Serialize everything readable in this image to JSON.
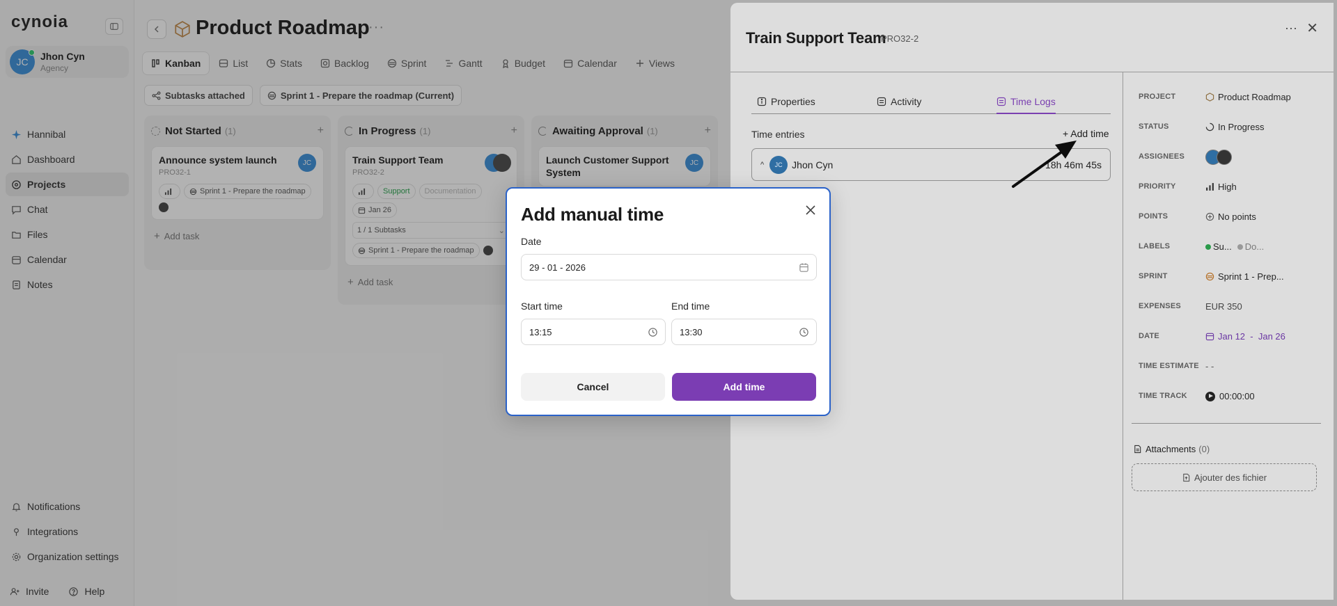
{
  "app": {
    "logo": "cynoia"
  },
  "user": {
    "initials": "JC",
    "name": "Jhon Cyn",
    "role": "Agency"
  },
  "nav": {
    "items": [
      {
        "label": "Hannibal"
      },
      {
        "label": "Dashboard"
      },
      {
        "label": "Projects"
      },
      {
        "label": "Chat"
      },
      {
        "label": "Files"
      },
      {
        "label": "Calendar"
      },
      {
        "label": "Notes"
      }
    ],
    "bottom": [
      {
        "label": "Notifications"
      },
      {
        "label": "Integrations"
      },
      {
        "label": "Organization settings"
      }
    ],
    "invite": "Invite",
    "help": "Help"
  },
  "page": {
    "title": "Product Roadmap",
    "more": "···"
  },
  "view_tabs": [
    "Kanban",
    "List",
    "Stats",
    "Backlog",
    "Sprint",
    "Gantt",
    "Budget",
    "Calendar",
    "Views"
  ],
  "filters": {
    "subtasks": "Subtasks attached",
    "sprint": "Sprint 1 - Prepare the roadmap (Current)"
  },
  "columns": [
    {
      "title": "Not Started",
      "count": "(1)",
      "card": {
        "title": "Announce system launch",
        "id": "PRO32-1",
        "avatar": "JC",
        "sprint": "Sprint 1 - Prepare the roadmap"
      },
      "add_task": "Add task"
    },
    {
      "title": "In Progress",
      "count": "(1)",
      "card": {
        "title": "Train Support Team",
        "id": "PRO32-2",
        "tag1": "Support",
        "tag2": "Documentation",
        "date": "Jan 26",
        "subtasks": "1 / 1 Subtasks",
        "sprint": "Sprint 1 - Prepare the roadmap"
      },
      "add_task": "Add task"
    },
    {
      "title": "Awaiting Approval",
      "count": "(1)",
      "card": {
        "title": "Launch Customer Support System",
        "avatar": "JC"
      }
    }
  ],
  "panel": {
    "title": "Train Support Team",
    "id": "PRO32-2",
    "tabs": [
      "Properties",
      "Activity",
      "Time Logs"
    ],
    "time_entries_label": "Time entries",
    "add_time_link": "+ Add time",
    "entry": {
      "initials": "JC",
      "name": "Jhon Cyn",
      "total": "18h 46m 45s"
    },
    "props": {
      "project": {
        "label": "PROJECT",
        "value": "Product Roadmap"
      },
      "status": {
        "label": "STATUS",
        "value": "In Progress"
      },
      "assignees": {
        "label": "ASSIGNEES"
      },
      "priority": {
        "label": "PRIORITY",
        "value": "High"
      },
      "points": {
        "label": "POINTS",
        "value": "No points"
      },
      "labels": {
        "label": "LABELS",
        "value1": "Su...",
        "value2": "Do..."
      },
      "sprint": {
        "label": "SPRINT",
        "value": "Sprint 1 - Prep..."
      },
      "expenses": {
        "label": "EXPENSES",
        "value": "EUR 350"
      },
      "date": {
        "label": "DATE",
        "start": "Jan 12",
        "sep": "-",
        "end": "Jan 26"
      },
      "estimate": {
        "label": "TIME ESTIMATE",
        "value": "- -"
      },
      "track": {
        "label": "TIME TRACK",
        "value": "00:00:00"
      }
    },
    "attachments": {
      "label": "Attachments",
      "count": "(0)",
      "drop": "Ajouter des fichier"
    }
  },
  "modal": {
    "title": "Add manual time",
    "date_label": "Date",
    "date_value": "29 - 01 - 2026",
    "start_label": "Start time",
    "start_value": "13:15",
    "end_label": "End time",
    "end_value": "13:30",
    "cancel": "Cancel",
    "submit": "Add time"
  },
  "colors": {
    "accent": "#7b3db3",
    "avatar": "#3b8fd9",
    "modal_border": "#2a62c9"
  }
}
